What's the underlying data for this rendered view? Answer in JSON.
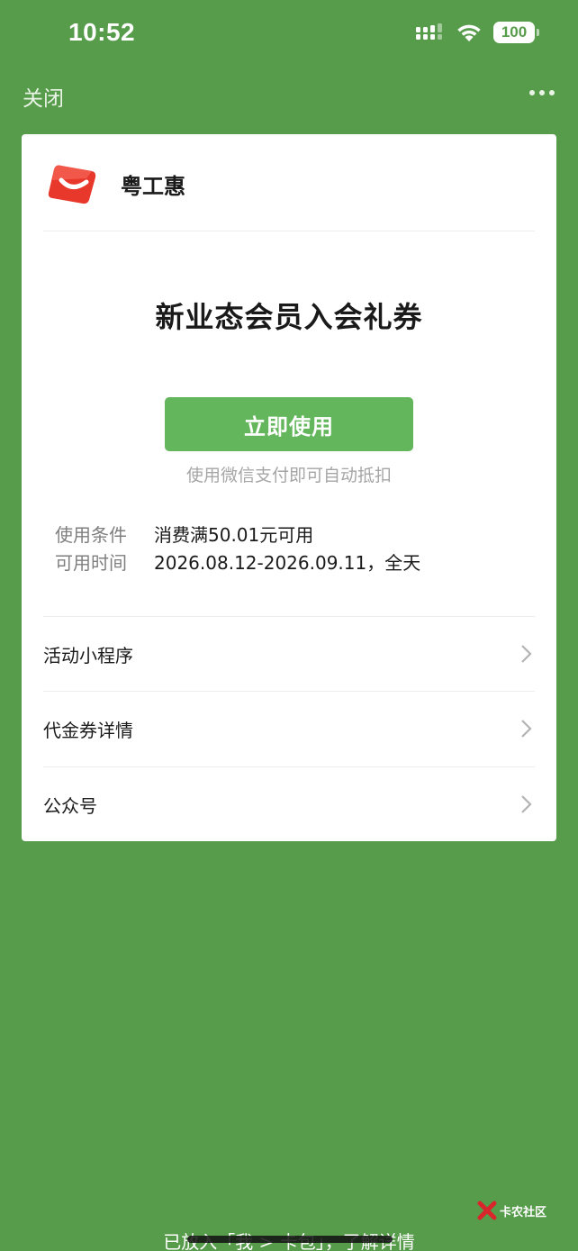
{
  "status_bar": {
    "time": "10:52",
    "battery": "100"
  },
  "nav": {
    "close_label": "关闭"
  },
  "merchant": {
    "name": "粤工惠"
  },
  "coupon": {
    "title": "新业态会员入会礼券",
    "use_button_label": "立即使用",
    "use_hint": "使用微信支付即可自动抵扣",
    "condition_label": "使用条件",
    "condition_value": "消费满50.01元可用",
    "time_label": "可用时间",
    "time_value": "2026.08.12-2026.09.11，全天"
  },
  "links": [
    {
      "label": "活动小程序"
    },
    {
      "label": "代金券详情"
    },
    {
      "label": "公众号"
    }
  ],
  "footer": {
    "hint": "已放入「我 > 卡包」，了解详情",
    "watermark": "卡农社区"
  },
  "colors": {
    "background": "#579c4b",
    "button": "#64b65c",
    "logo_red": "#e8382c"
  }
}
